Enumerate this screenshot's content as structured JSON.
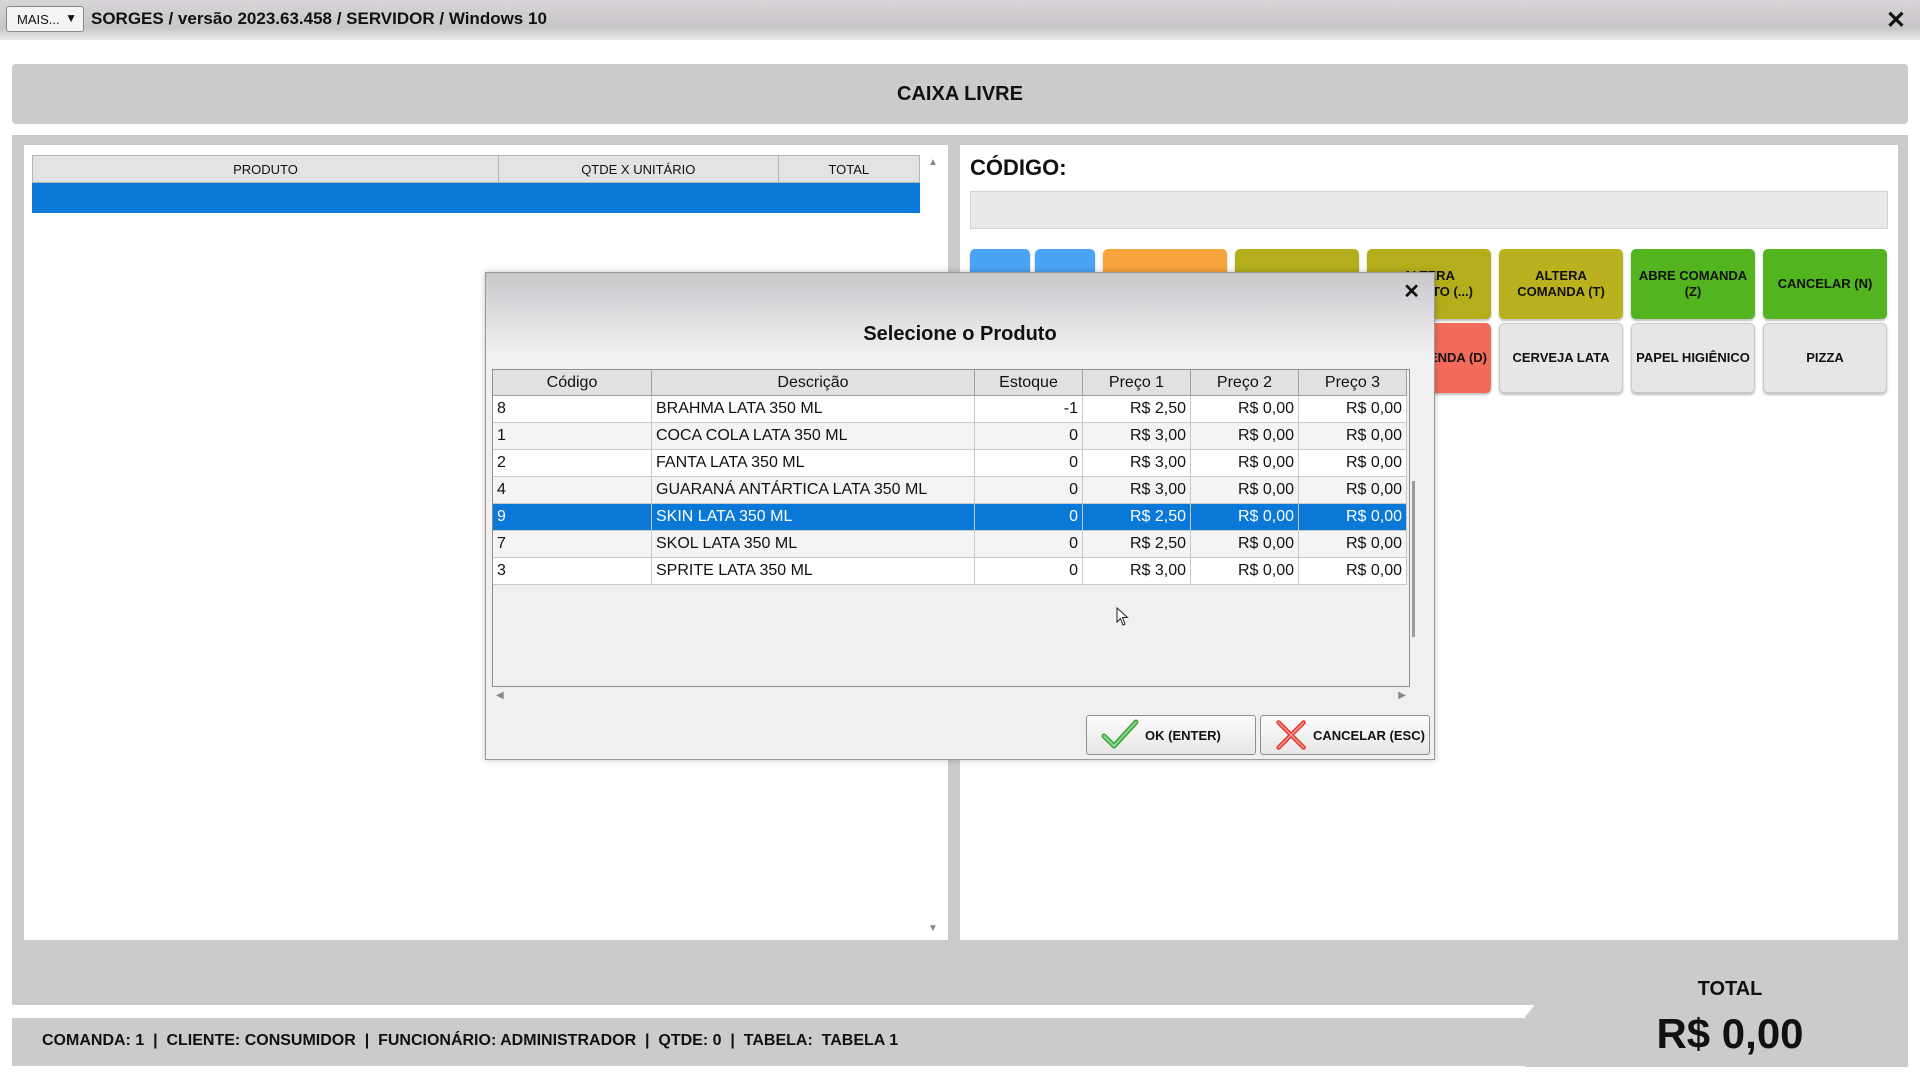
{
  "titlebar": {
    "mais_label": "MAIS...",
    "mais_arrow": "▼",
    "title": "SORGES / versão 2023.63.458 / SERVIDOR / Windows 10",
    "close_glyph": "✕"
  },
  "header": {
    "caixa_status": "CAIXA LIVRE"
  },
  "cart": {
    "columns": [
      "PRODUTO",
      "QTDE X UNITÁRIO",
      "TOTAL"
    ],
    "scroll_up": "▲",
    "scroll_down": "▼"
  },
  "right": {
    "codigo_label": "CÓDIGO:",
    "codigo_value": "",
    "buttons_row1": [
      {
        "label": "",
        "color": "#4aa3f5"
      },
      {
        "label": "",
        "color": "#4aa3f5"
      },
      {
        "label": "",
        "color": "#f8a43c"
      },
      {
        "label": "",
        "color": "#b4ae1d"
      },
      {
        "label": "ALTERA PRODUTO (...)",
        "color": "#b4ae1d"
      },
      {
        "label": "ALTERA COMANDA (T)",
        "color": "#b9b21e"
      },
      {
        "label": "ABRE COMANDA (Z)",
        "color": "#52b41f"
      },
      {
        "label": "CANCELAR (N)",
        "color": "#52b41f"
      }
    ],
    "buttons_row2": [
      {
        "label": "...ENDA (D)",
        "color": "#f26b5b"
      },
      {
        "label": "CERVEJA LATA",
        "color": "#e6e6e6"
      },
      {
        "label": "PAPEL HIGIÊNICO",
        "color": "#e6e6e6"
      },
      {
        "label": "PIZZA",
        "color": "#e6e6e6"
      }
    ]
  },
  "status": {
    "line": "COMANDA: 1  |  CLIENTE: CONSUMIDOR  |  FUNCIONÁRIO: ADMINISTRADOR  |  QTDE: 0  |  TABELA:  TABELA 1",
    "total_label": "TOTAL",
    "total_value": "R$ 0,00"
  },
  "dialog": {
    "title": "Selecione o Produto",
    "close_glyph": "✕",
    "columns": [
      "Código",
      "Descrição",
      "Estoque",
      "Preço 1",
      "Preço 2",
      "Preço 3"
    ],
    "rows": [
      [
        "8",
        "BRAHMA LATA 350 ML",
        "-1",
        "R$ 2,50",
        "R$ 0,00",
        "R$ 0,00"
      ],
      [
        "1",
        "COCA COLA LATA 350 ML",
        "0",
        "R$ 3,00",
        "R$ 0,00",
        "R$ 0,00"
      ],
      [
        "2",
        "FANTA LATA 350 ML",
        "0",
        "R$ 3,00",
        "R$ 0,00",
        "R$ 0,00"
      ],
      [
        "4",
        "GUARANÁ ANTÁRTICA LATA 350 ML",
        "0",
        "R$ 3,00",
        "R$ 0,00",
        "R$ 0,00"
      ],
      [
        "9",
        "SKIN LATA 350 ML",
        "0",
        "R$ 2,50",
        "R$ 0,00",
        "R$ 0,00"
      ],
      [
        "7",
        "SKOL LATA 350 ML",
        "0",
        "R$ 2,50",
        "R$ 0,00",
        "R$ 0,00"
      ],
      [
        "3",
        "SPRITE LATA 350 ML",
        "0",
        "R$ 3,00",
        "R$ 0,00",
        "R$ 0,00"
      ]
    ],
    "selected_row": 4,
    "scroll_left": "◀",
    "scroll_right": "▶",
    "ok_label": "OK (ENTER)",
    "cancel_label": "CANCELAR (ESC)",
    "ok_icon": "check-icon",
    "cancel_icon": "x-icon"
  },
  "colors": {
    "selection": "#0a78d7",
    "frame": "#cdcacd"
  }
}
